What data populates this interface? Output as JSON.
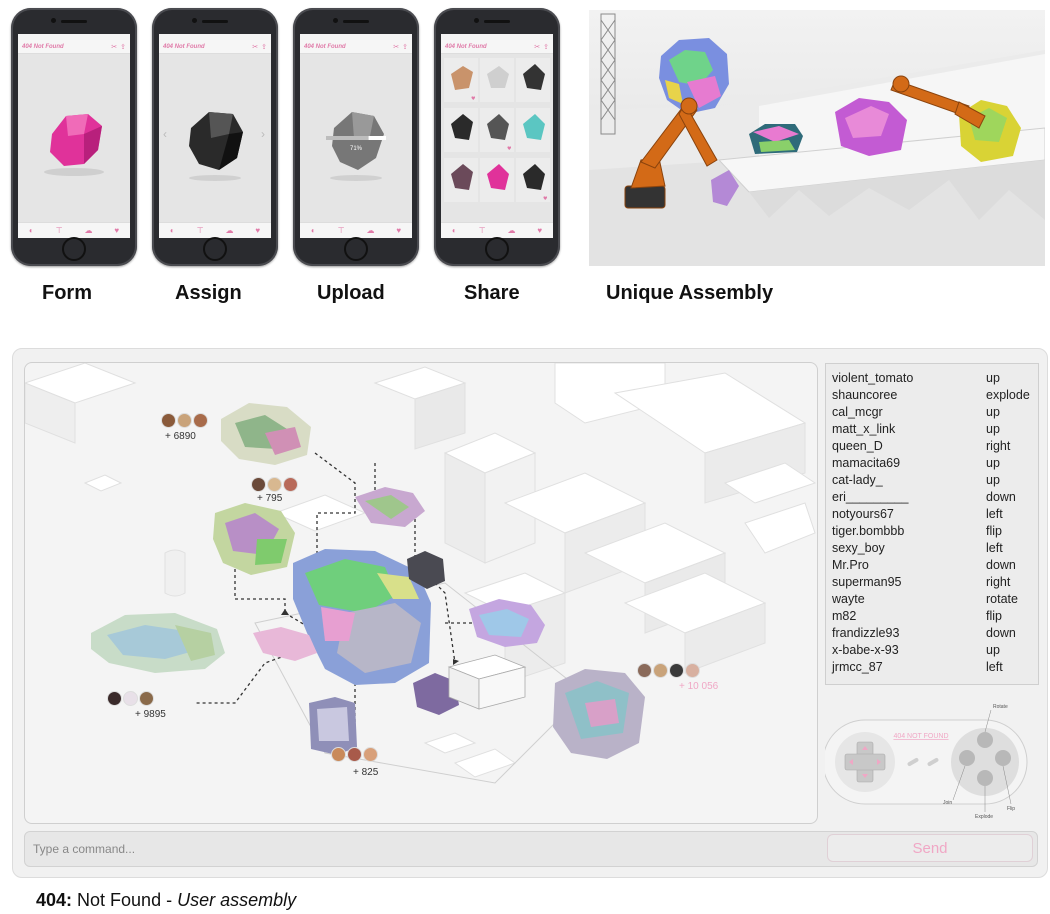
{
  "app": {
    "title": "404 Not Found",
    "progress_label": "71%",
    "progress": 0.71
  },
  "steps": [
    {
      "caption": "Form"
    },
    {
      "caption": "Assign"
    },
    {
      "caption": "Upload"
    },
    {
      "caption": "Share"
    }
  ],
  "scene_caption": "Unique Assembly",
  "clusters": [
    {
      "count": "+ 6890"
    },
    {
      "count": "+ 795"
    },
    {
      "count": "+ 9895"
    },
    {
      "count": "+ 825"
    },
    {
      "count": "+ 10 056"
    }
  ],
  "log": [
    {
      "user": "violent_tomato",
      "cmd": "up"
    },
    {
      "user": "shauncoree",
      "cmd": "explode"
    },
    {
      "user": "cal_mcgr",
      "cmd": "up"
    },
    {
      "user": "matt_x_link",
      "cmd": "up"
    },
    {
      "user": "queen_D",
      "cmd": "right"
    },
    {
      "user": "mamacita69",
      "cmd": "up"
    },
    {
      "user": "cat-lady_",
      "cmd": "up"
    },
    {
      "user": "eri_________",
      "cmd": "down"
    },
    {
      "user": "notyours67",
      "cmd": "left"
    },
    {
      "user": "tiger.bombbb",
      "cmd": "flip"
    },
    {
      "user": "sexy_boy",
      "cmd": "left"
    },
    {
      "user": "Mr.Pro",
      "cmd": "down"
    },
    {
      "user": "superman95",
      "cmd": "right"
    },
    {
      "user": "wayte",
      "cmd": "rotate"
    },
    {
      "user": "m82",
      "cmd": "flip"
    },
    {
      "user": "frandizzle93",
      "cmd": "down"
    },
    {
      "user": "x-babe-x-93",
      "cmd": "up"
    },
    {
      "user": "jrmcc_87",
      "cmd": "left"
    }
  ],
  "controller": {
    "title": "404 NOT FOUND",
    "labels": {
      "rotate": "Rotate",
      "join": "Join",
      "explode": "Explode",
      "flip": "Flip"
    }
  },
  "command": {
    "placeholder": "Type a command...",
    "send_label": "Send"
  },
  "footer": {
    "code": "404:",
    "title": " Not Found - ",
    "subtitle": "User assembly"
  },
  "colors": {
    "accent": "#f0a7c5",
    "form_rock": "#e0329a",
    "robot": "#d36a17"
  }
}
